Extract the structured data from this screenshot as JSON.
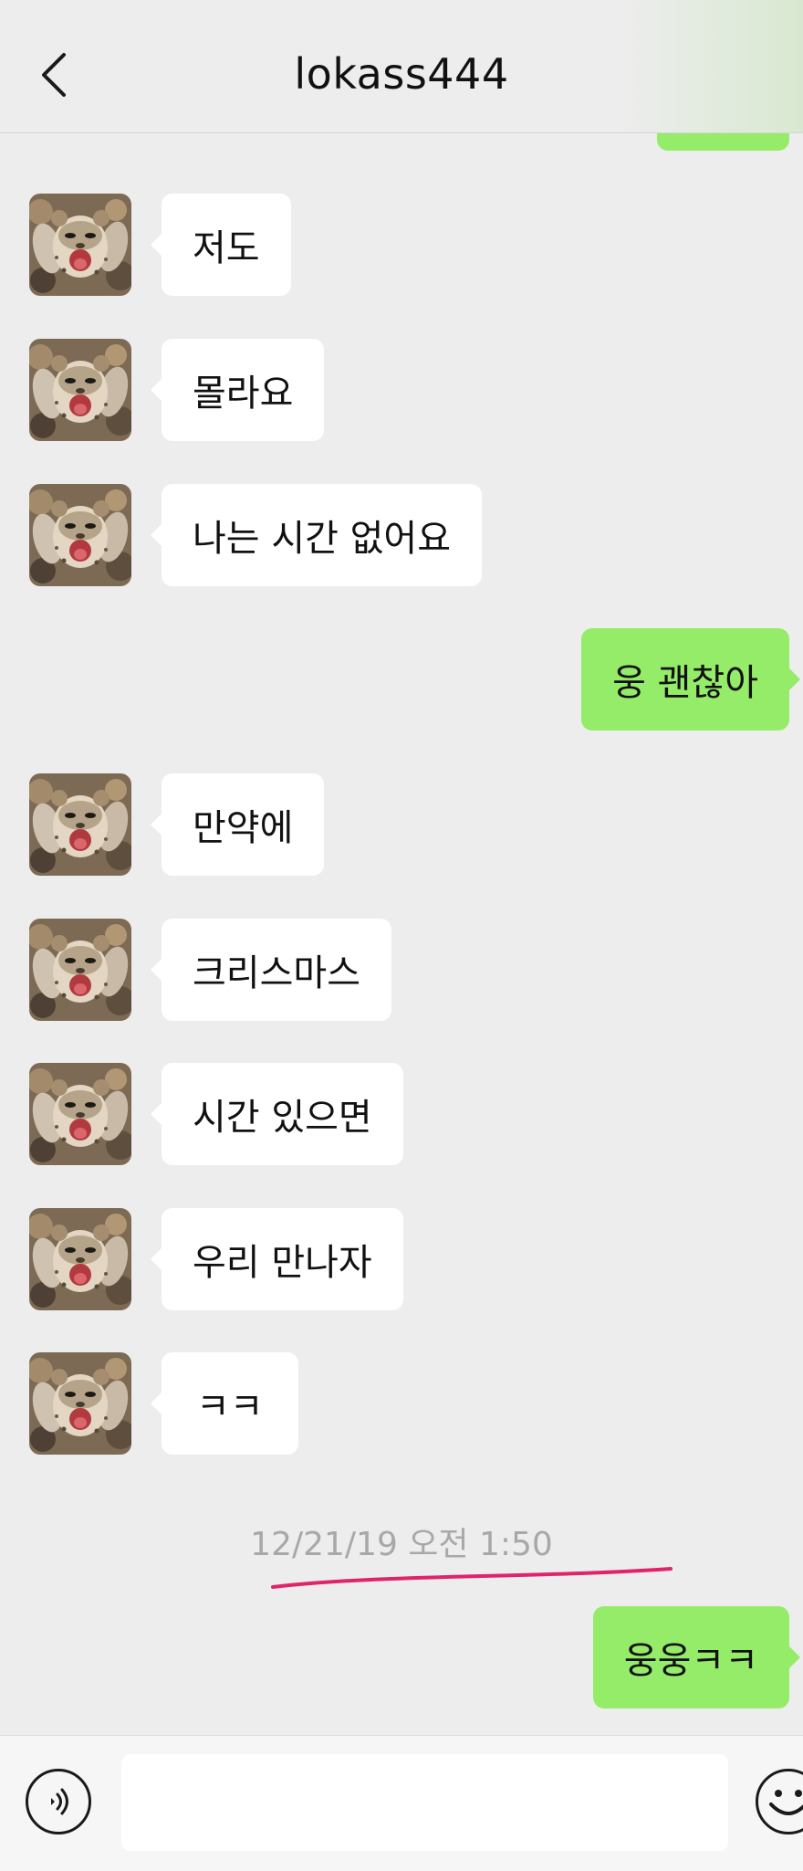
{
  "header": {
    "title": "lokass444",
    "back_icon": "chevron-left-icon"
  },
  "messages": [
    {
      "side": "in",
      "text": "저도"
    },
    {
      "side": "in",
      "text": "몰라요"
    },
    {
      "side": "in",
      "text": "나는 시간 없어요"
    },
    {
      "side": "out",
      "text": "웅 괜찮아"
    },
    {
      "side": "in",
      "text": "만약에"
    },
    {
      "side": "in",
      "text": "크리스마스"
    },
    {
      "side": "in",
      "text": "시간 있으면"
    },
    {
      "side": "in",
      "text": "우리 만나자"
    },
    {
      "side": "in",
      "text": "ㅋㅋ"
    },
    {
      "side": "out",
      "text": "웅웅ㅋㅋ"
    }
  ],
  "timestamp": "12/21/19 오전 1:50",
  "input_bar": {
    "voice_icon": "voice-icon",
    "input_value": "",
    "emoji_icon": "emoji-icon"
  },
  "colors": {
    "background": "#ededed",
    "incoming_bubble": "#ffffff",
    "outgoing_bubble": "#95ec69",
    "annotation_underline": "#e0246a",
    "timestamp_text": "#a8a8a8"
  }
}
